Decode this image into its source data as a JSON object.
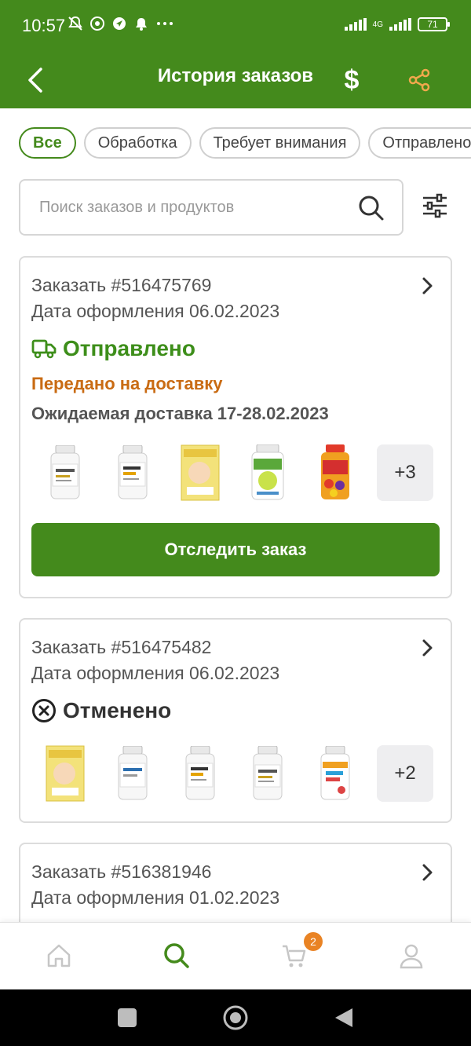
{
  "status_bar": {
    "time": "10:57",
    "network": "4G",
    "battery": "71"
  },
  "header": {
    "title": "История заказов",
    "currency_symbol": "$"
  },
  "filters": [
    "Все",
    "Обработка",
    "Требует внимания",
    "Отправлено"
  ],
  "search": {
    "placeholder": "Поиск заказов и продуктов"
  },
  "orders": [
    {
      "order_number": "Заказать #516475769",
      "order_date": "Дата оформления 06.02.2023",
      "status": "Отправлено",
      "substatus": "Передано на доставку",
      "eta": "Ожидаемая доставка 17-28.02.2023",
      "more_count": "+3",
      "track_label": "Отследить заказ"
    },
    {
      "order_number": "Заказать #516475482",
      "order_date": "Дата оформления 06.02.2023",
      "status": "Отменено",
      "more_count": "+2"
    },
    {
      "order_number": "Заказать #516381946",
      "order_date": "Дата оформления 01.02.2023"
    }
  ],
  "bottom_nav": {
    "cart_badge": "2"
  },
  "colors": {
    "brand_green": "#448a1c",
    "accent_orange": "#e98324",
    "shipped_green": "#3d8e1a",
    "delivery_orange": "#c96b13"
  }
}
